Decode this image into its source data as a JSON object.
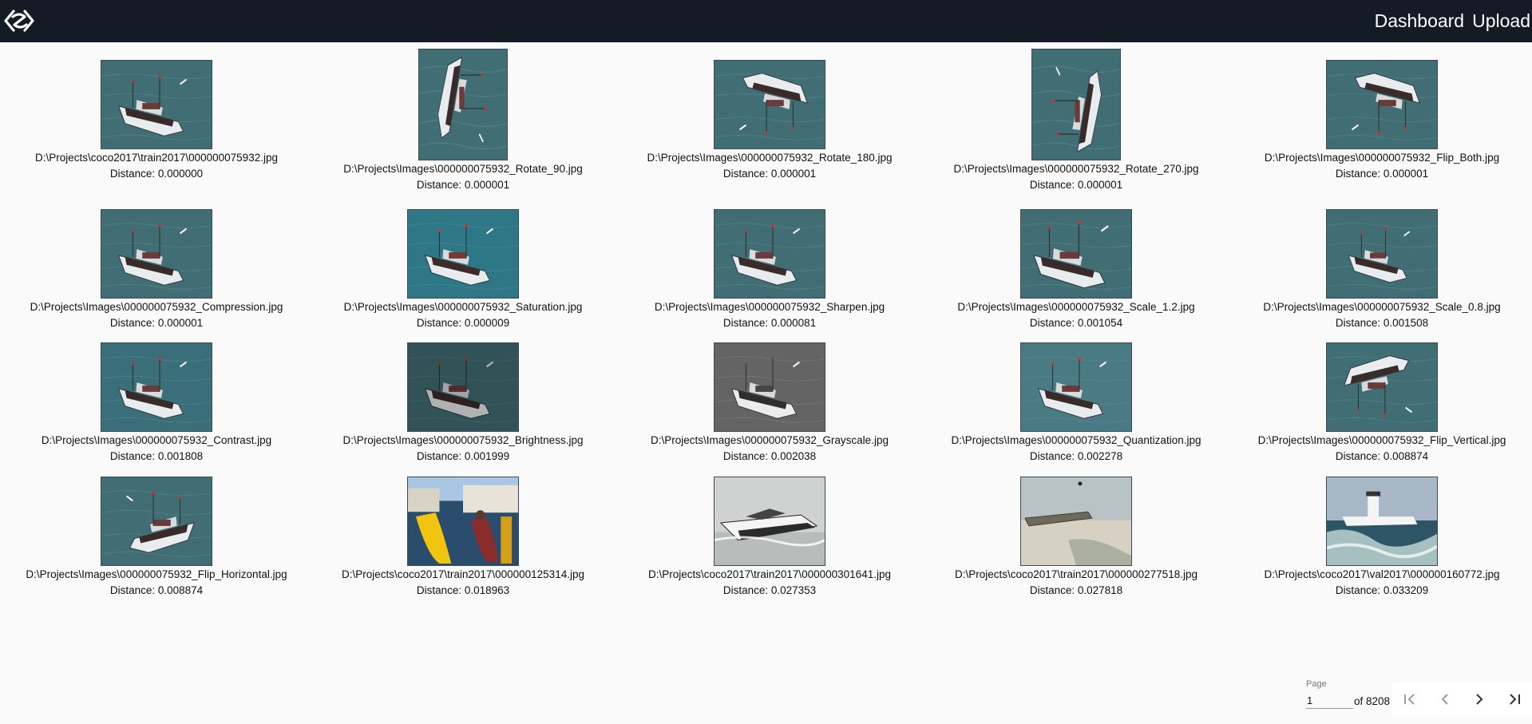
{
  "header": {
    "logo_icon": "app-logo-icon",
    "nav": [
      "Dashboard",
      "Upload"
    ]
  },
  "results": [
    {
      "path": "D:\\Projects\\coco2017\\train2017\\000000075932.jpg",
      "distance": "Distance: 0.000000",
      "image": "boat-original"
    },
    {
      "path": "D:\\Projects\\Images\\000000075932_Rotate_90.jpg",
      "distance": "Distance: 0.000001",
      "image": "boat-rotate-90"
    },
    {
      "path": "D:\\Projects\\Images\\000000075932_Rotate_180.jpg",
      "distance": "Distance: 0.000001",
      "image": "boat-rotate-180"
    },
    {
      "path": "D:\\Projects\\Images\\000000075932_Rotate_270.jpg",
      "distance": "Distance: 0.000001",
      "image": "boat-rotate-270"
    },
    {
      "path": "D:\\Projects\\Images\\000000075932_Flip_Both.jpg",
      "distance": "Distance: 0.000001",
      "image": "boat-flip-both"
    },
    {
      "path": "D:\\Projects\\Images\\000000075932_Compression.jpg",
      "distance": "Distance: 0.000001",
      "image": "boat-compression"
    },
    {
      "path": "D:\\Projects\\Images\\000000075932_Saturation.jpg",
      "distance": "Distance: 0.000009",
      "image": "boat-saturation"
    },
    {
      "path": "D:\\Projects\\Images\\000000075932_Sharpen.jpg",
      "distance": "Distance: 0.000081",
      "image": "boat-sharpen"
    },
    {
      "path": "D:\\Projects\\Images\\000000075932_Scale_1.2.jpg",
      "distance": "Distance: 0.001054",
      "image": "boat-scale-1.2"
    },
    {
      "path": "D:\\Projects\\Images\\000000075932_Scale_0.8.jpg",
      "distance": "Distance: 0.001508",
      "image": "boat-scale-0.8"
    },
    {
      "path": "D:\\Projects\\Images\\000000075932_Contrast.jpg",
      "distance": "Distance: 0.001808",
      "image": "boat-contrast"
    },
    {
      "path": "D:\\Projects\\Images\\000000075932_Brightness.jpg",
      "distance": "Distance: 0.001999",
      "image": "boat-brightness"
    },
    {
      "path": "D:\\Projects\\Images\\000000075932_Grayscale.jpg",
      "distance": "Distance: 0.002038",
      "image": "boat-grayscale"
    },
    {
      "path": "D:\\Projects\\Images\\000000075932_Quantization.jpg",
      "distance": "Distance: 0.002278",
      "image": "boat-quantization"
    },
    {
      "path": "D:\\Projects\\Images\\000000075932_Flip_Vertical.jpg",
      "distance": "Distance: 0.008874",
      "image": "boat-flip-vertical"
    },
    {
      "path": "D:\\Projects\\Images\\000000075932_Flip_Horizontal.jpg",
      "distance": "Distance: 0.008874",
      "image": "boat-flip-horizontal"
    },
    {
      "path": "D:\\Projects\\coco2017\\train2017\\000000125314.jpg",
      "distance": "Distance: 0.018963",
      "image": "canal-boats"
    },
    {
      "path": "D:\\Projects\\coco2017\\train2017\\000000301641.jpg",
      "distance": "Distance: 0.027353",
      "image": "speedboat"
    },
    {
      "path": "D:\\Projects\\coco2017\\train2017\\000000277518.jpg",
      "distance": "Distance: 0.027818",
      "image": "beached-rowboat"
    },
    {
      "path": "D:\\Projects\\coco2017\\val2017\\000000160772.jpg",
      "distance": "Distance: 0.033209",
      "image": "lighthouse-ship"
    }
  ],
  "pagination": {
    "label": "Page",
    "current": "1",
    "of_text": "of 8208",
    "buttons": [
      "first-page-icon",
      "previous-page-icon",
      "next-page-icon",
      "last-page-icon"
    ]
  },
  "colors": {
    "header_bg": "#141b24",
    "page_bg": "#fafafa",
    "water": "#3f6b72"
  }
}
